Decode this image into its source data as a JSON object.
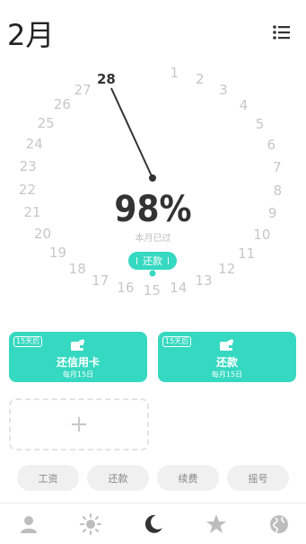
{
  "header": {
    "month": "2月",
    "menu_icon": "list-menu-icon"
  },
  "dial": {
    "days": [
      "1",
      "2",
      "3",
      "4",
      "5",
      "6",
      "7",
      "8",
      "9",
      "10",
      "11",
      "12",
      "13",
      "14",
      "15",
      "16",
      "17",
      "18",
      "19",
      "20",
      "21",
      "22",
      "23",
      "24",
      "25",
      "26",
      "27",
      "28"
    ],
    "current_day": "28",
    "progress_percent": 98,
    "percent_label": "98%",
    "percent_caption": "本月已过",
    "marker_label": "还款",
    "colors": {
      "accent": "#35d8c0",
      "hand": "#333333",
      "day": "#c7c7c7"
    }
  },
  "cards": [
    {
      "badge": "15天后",
      "title": "还信用卡",
      "subtitle": "每月15日",
      "icon": "wallet-icon"
    },
    {
      "badge": "15天后",
      "title": "还款",
      "subtitle": "每月15日",
      "icon": "wallet-icon"
    }
  ],
  "add_card": {
    "symbol": "+"
  },
  "chips": [
    "工资",
    "还款",
    "续费",
    "摇号"
  ],
  "tabbar": {
    "tabs": [
      {
        "icon": "person-icon",
        "active": false
      },
      {
        "icon": "sun-icon",
        "active": false
      },
      {
        "icon": "moon-icon",
        "active": true
      },
      {
        "icon": "star-icon",
        "active": false
      },
      {
        "icon": "globe-icon",
        "active": false
      }
    ]
  }
}
